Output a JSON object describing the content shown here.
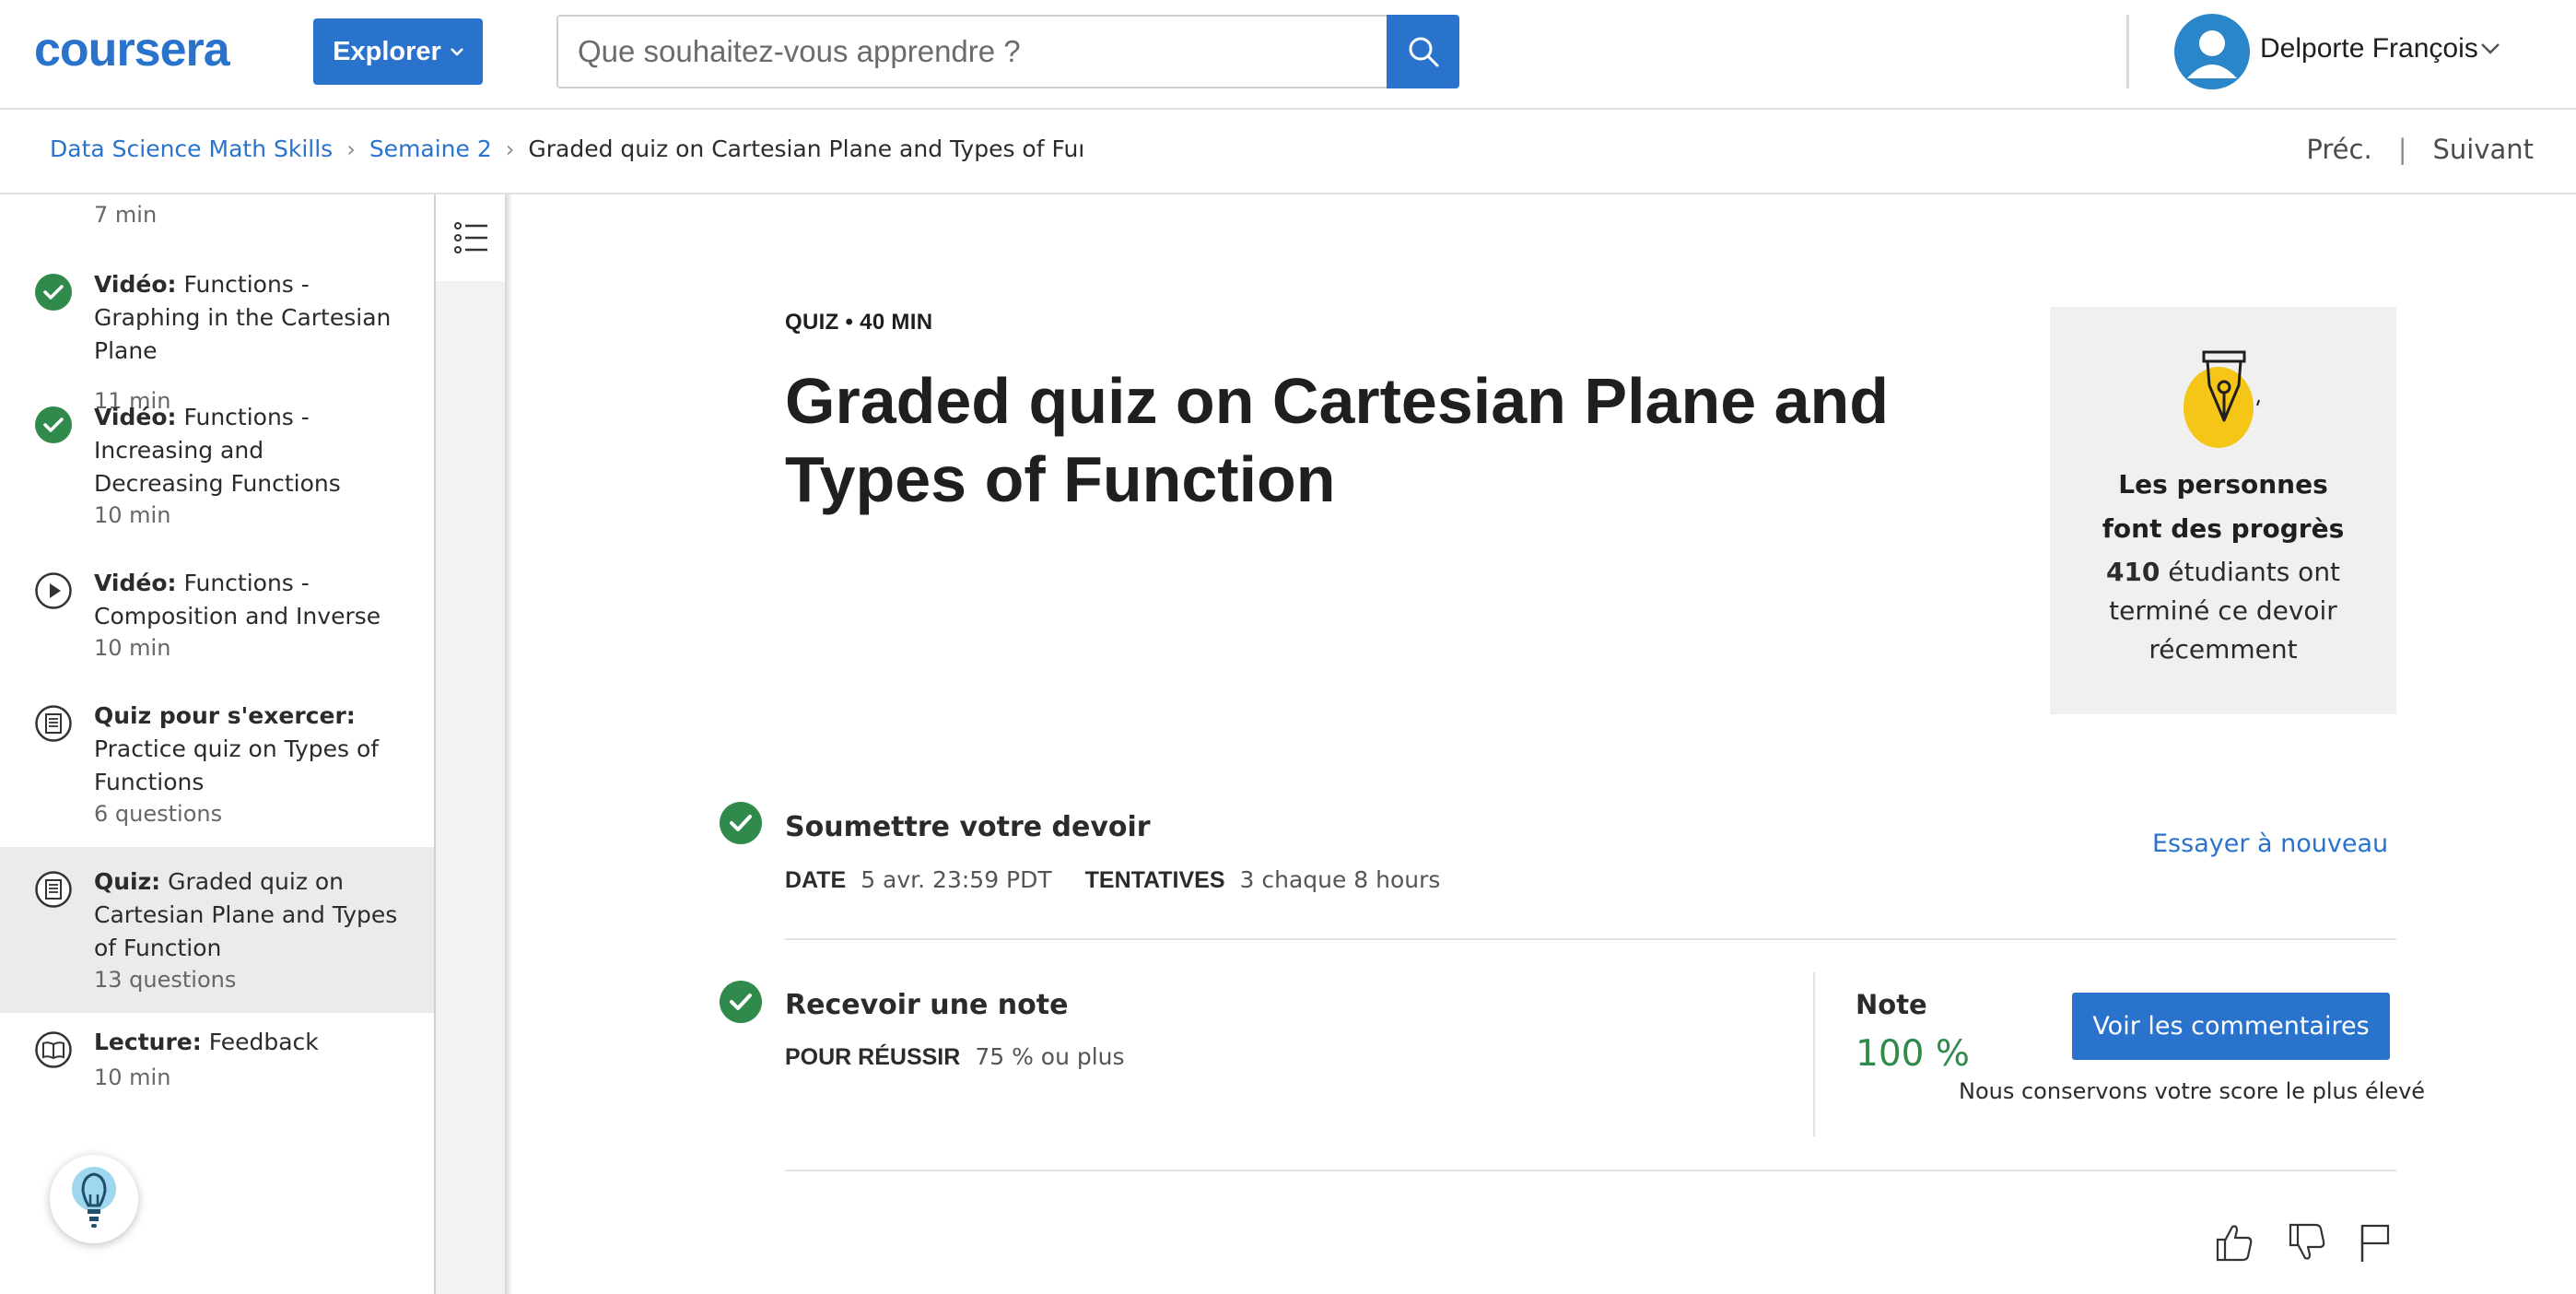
{
  "header": {
    "logo": "coursera",
    "explore_label": "Explorer",
    "search": {
      "placeholder": "Que souhaitez-vous apprendre ?",
      "value": ""
    },
    "user_name": "Delporte François"
  },
  "breadcrumb": {
    "items": [
      "Data Science Math Skills",
      "Semaine 2"
    ],
    "current": "Graded quiz on Cartesian Plane and Types of Function"
  },
  "nav": {
    "prev": "Préc.",
    "next": "Suivant"
  },
  "sidebar": {
    "top_duration": "7  min",
    "items": [
      {
        "type": "Vidéo:",
        "title": " Functions - Graphing in the Cartesian Plane",
        "meta": "11  min",
        "status": "completed"
      },
      {
        "type": "Vidéo:",
        "title": " Functions - Increasing and Decreasing Functions",
        "meta": "10  min",
        "status": "completed"
      },
      {
        "type": "Vidéo:",
        "title": " Functions - Composition and Inverse",
        "meta": "10  min",
        "status": "play"
      },
      {
        "type": "Quiz pour s'exercer:",
        "title": " Practice quiz on Types of Functions",
        "meta": "6 questions",
        "status": "quiz"
      },
      {
        "type": "Quiz:",
        "title": " Graded quiz on Cartesian Plane and Types of Function",
        "meta": "13 questions",
        "status": "quiz-active"
      },
      {
        "type": "Lecture:",
        "title": " Feedback",
        "meta": "10  min",
        "status": "reading"
      }
    ]
  },
  "quiz": {
    "meta": "QUIZ • 40  MIN",
    "title": "Graded quiz on Cartesian Plane and Types of Function"
  },
  "progress_card": {
    "title": "Les personnes font des progrès",
    "count": "410",
    "body": " étudiants ont terminé ce devoir récemment"
  },
  "submit": {
    "title": "Soumettre votre devoir",
    "date_label": "DATE",
    "date_value": "5 avr. 23:59 PDT",
    "attempts_label": "TENTATIVES",
    "attempts_value": "3 chaque 8  hours",
    "retry": "Essayer à nouveau"
  },
  "grade": {
    "title": "Recevoir une note",
    "pass_label": "POUR RÉUSSIR",
    "pass_value": "75 % ou plus",
    "note_label": "Note",
    "note_value": "100 %",
    "feedback_button": "Voir les commentaires",
    "keep_note": "Nous conservons votre score le plus élevé"
  },
  "colors": {
    "brand": "#2a73cc",
    "success": "#2f8a4b",
    "accent_yellow": "#f5c518"
  },
  "icons": [
    "search-icon",
    "chevron-down-icon",
    "user-avatar-icon",
    "check-circle-icon",
    "play-circle-icon",
    "quiz-icon",
    "reading-icon",
    "list-icon",
    "lightbulb-icon",
    "pen-nib-icon",
    "thumbs-up-icon",
    "thumbs-down-icon",
    "flag-icon"
  ]
}
